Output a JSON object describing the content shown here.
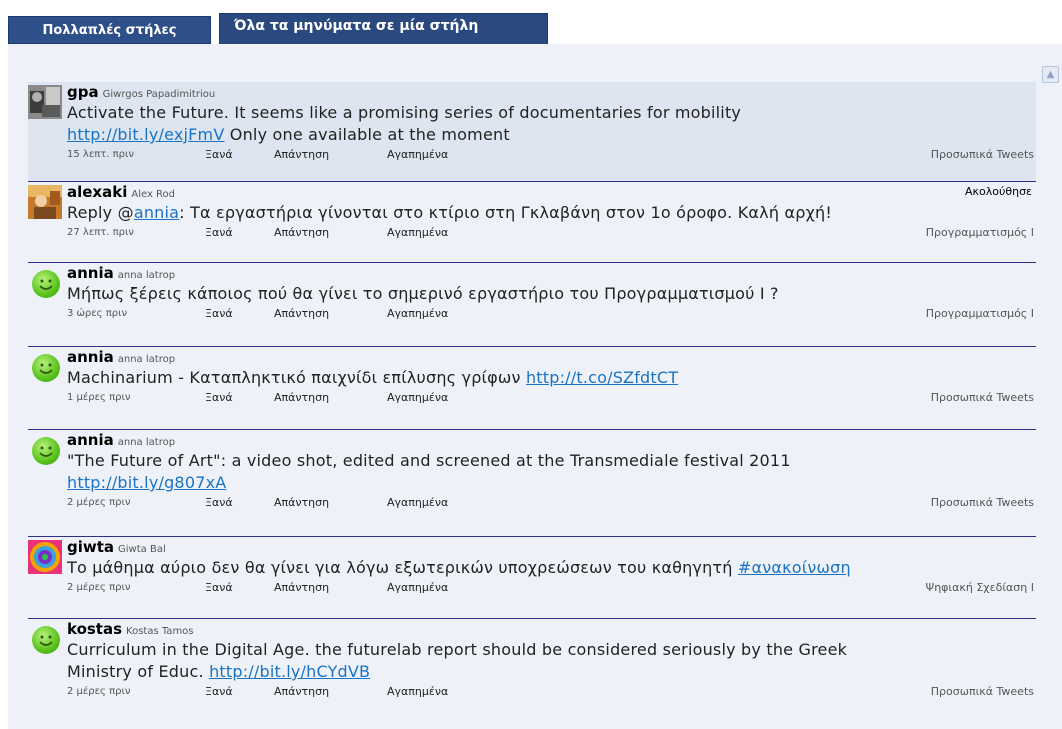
{
  "tabs": {
    "multi_column": "Πολλαπλές στήλες",
    "single_column": "Όλα τα μηνύματα σε μία στήλη"
  },
  "actions": {
    "retweet": "Ξανά",
    "reply": "Απάντηση",
    "favorite": "Αγαπημένα"
  },
  "tweets": [
    {
      "user": "gpa",
      "fullname": "Giwrgos Papadimitriou",
      "line1": "Activate the Future. It seems like a promising series of documentaries for mobility",
      "link": "http://bit.ly/exjFmV",
      "after": " Only one available at the moment",
      "time": "15 λεπτ. πριν",
      "list": "Προσωπικά Tweets",
      "avatar": "photo-avatar-gray"
    },
    {
      "user": "alexaki",
      "fullname": "Alex Rod",
      "follow": "Ακολούθησε",
      "before": "Reply @",
      "mention": "annia",
      "after": ": Τα εργαστήρια γίνονται στο κτίριο στη Γκλαβάνη στον 1ο όροφο. Καλή αρχή!",
      "time": "27 λεπτ. πριν",
      "list": "Προγραμματισμός Ι",
      "avatar": "photo-avatar-warm"
    },
    {
      "user": "annia",
      "fullname": "anna latrop",
      "text": "Μήπως ξέρεις κάποιος πού θα γίνει το σημερινό εργαστήριο του Προγραμματισμού Ι ?",
      "time": "3 ώρες πριν",
      "list": "Προγραμματισμός Ι",
      "avatar": "smiley-icon"
    },
    {
      "user": "annia",
      "fullname": "anna latrop",
      "before": "Machinarium - Καταπληκτικό παιχνίδι επίλυσης γρίφων ",
      "link": "http://t.co/SZfdtCT",
      "time": "1 μέρες πριν",
      "list": "Προσωπικά Tweets",
      "avatar": "smiley-icon"
    },
    {
      "user": "annia",
      "fullname": "anna latrop",
      "line1": "\"The Future of Art\": a video shot, edited and screened at the Transmediale festival 2011",
      "link": "http://bit.ly/g807xA",
      "time": "2 μέρες πριν",
      "list": "Προσωπικά Tweets",
      "avatar": "smiley-icon"
    },
    {
      "user": "giwta",
      "fullname": "Giwta Bal",
      "before": "Το μάθημα αύριο δεν θα γίνει για λόγω εξωτερικών υποχρεώσεων του καθηγητή ",
      "hashtag": "#ανακοίνωση",
      "time": "2 μέρες πριν",
      "list": "Ψηφιακή Σχεδίαση Ι",
      "avatar": "swirl-avatar"
    },
    {
      "user": "kostas",
      "fullname": "Kostas Tamos",
      "line1": "Curriculum in the Digital Age. the futurelab report should be considered seriously by the Greek",
      "before2": "Ministry of Educ. ",
      "link": "http://bit.ly/hCYdVB",
      "time": "2 μέρες πριν",
      "list": "Προσωπικά Tweets",
      "avatar": "smiley-icon"
    }
  ],
  "colors": {
    "tab_bg": "#2d4f8a",
    "panel_bg": "#eef2f8",
    "link": "#1a73c4",
    "divider": "#2d2f8c"
  }
}
